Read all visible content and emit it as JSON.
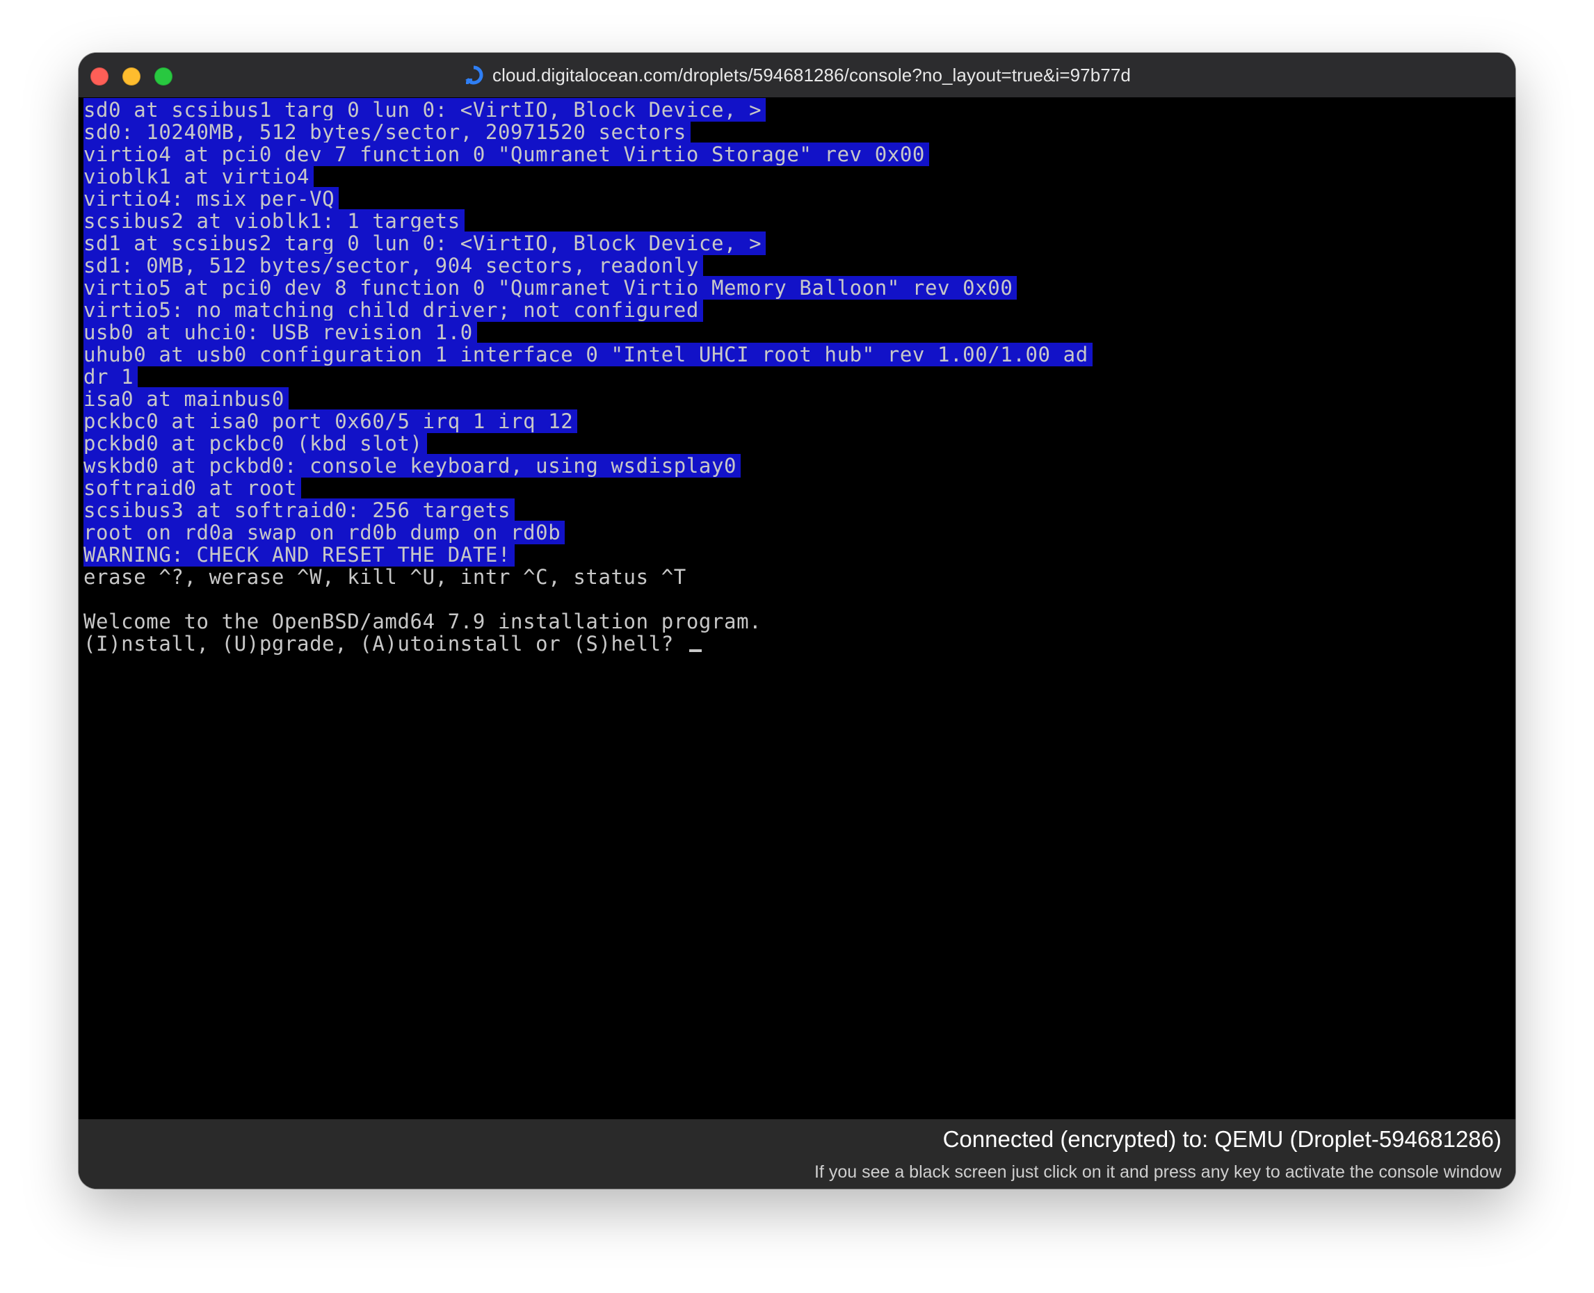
{
  "window": {
    "title": "cloud.digitalocean.com/droplets/594681286/console?no_layout=true&i=97b77d",
    "icon": "digitalocean-loading-icon",
    "controls": {
      "close": "close-window-icon",
      "minimize": "minimize-window-icon",
      "maximize": "maximize-window-icon"
    }
  },
  "terminal": {
    "highlight_color": "#1212c8",
    "text_color": "#c8c8c8",
    "lines": [
      {
        "text": "sd0 at scsibus1 targ 0 lun 0: <VirtIO, Block Device, >",
        "highlighted": true
      },
      {
        "text": "sd0: 10240MB, 512 bytes/sector, 20971520 sectors",
        "highlighted": true
      },
      {
        "text": "virtio4 at pci0 dev 7 function 0 \"Qumranet Virtio Storage\" rev 0x00",
        "highlighted": true
      },
      {
        "text": "vioblk1 at virtio4",
        "highlighted": true
      },
      {
        "text": "virtio4: msix per-VQ",
        "highlighted": true
      },
      {
        "text": "scsibus2 at vioblk1: 1 targets",
        "highlighted": true
      },
      {
        "text": "sd1 at scsibus2 targ 0 lun 0: <VirtIO, Block Device, >",
        "highlighted": true
      },
      {
        "text": "sd1: 0MB, 512 bytes/sector, 904 sectors, readonly",
        "highlighted": true
      },
      {
        "text": "virtio5 at pci0 dev 8 function 0 \"Qumranet Virtio Memory Balloon\" rev 0x00",
        "highlighted": true
      },
      {
        "text": "virtio5: no matching child driver; not configured",
        "highlighted": true
      },
      {
        "text": "usb0 at uhci0: USB revision 1.0",
        "highlighted": true
      },
      {
        "text": "uhub0 at usb0 configuration 1 interface 0 \"Intel UHCI root hub\" rev 1.00/1.00 ad",
        "highlighted": true
      },
      {
        "text": "dr 1",
        "highlighted": true
      },
      {
        "text": "isa0 at mainbus0",
        "highlighted": true
      },
      {
        "text": "pckbc0 at isa0 port 0x60/5 irq 1 irq 12",
        "highlighted": true
      },
      {
        "text": "pckbd0 at pckbc0 (kbd slot)",
        "highlighted": true
      },
      {
        "text": "wskbd0 at pckbd0: console keyboard, using wsdisplay0",
        "highlighted": true
      },
      {
        "text": "softraid0 at root",
        "highlighted": true
      },
      {
        "text": "scsibus3 at softraid0: 256 targets",
        "highlighted": true
      },
      {
        "text": "root on rd0a swap on rd0b dump on rd0b",
        "highlighted": true
      },
      {
        "text": "WARNING: CHECK AND RESET THE DATE!",
        "highlighted": true
      },
      {
        "text": "erase ^?, werase ^W, kill ^U, intr ^C, status ^T",
        "highlighted": false
      },
      {
        "text": "",
        "highlighted": false
      },
      {
        "text": "Welcome to the OpenBSD/amd64 7.9 installation program.",
        "highlighted": false
      },
      {
        "text": "(I)nstall, (U)pgrade, (A)utoinstall or (S)hell? ",
        "highlighted": false,
        "cursor": true
      }
    ]
  },
  "status": {
    "connection": "Connected (encrypted) to: QEMU (Droplet-594681286)",
    "hint": "If you see a black screen just click on it and press any key to activate the console window"
  }
}
